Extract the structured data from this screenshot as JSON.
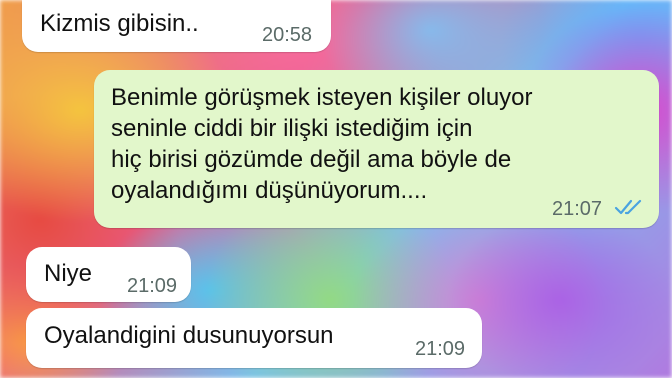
{
  "chat": {
    "messages": [
      {
        "direction": "incoming",
        "text": "Kizmis gibisin..",
        "time": "20:58"
      },
      {
        "direction": "outgoing",
        "text": "Benimle görüşmek isteyen kişiler oluyor\nseninle ciddi bir ilişki istediğim için\nhiç birisi gözümde değil ama böyle de\noyalandığımı düşünüyorum....",
        "time": "21:07",
        "status_icon": "double-check-read-icon",
        "status_color": "#4aa3e0"
      },
      {
        "direction": "incoming",
        "text": "Niye",
        "time": "21:09"
      },
      {
        "direction": "incoming",
        "text": "Oyalandigini dusunuyorsun",
        "time": "21:09"
      }
    ]
  },
  "colors": {
    "incoming_bubble": "#ffffff",
    "outgoing_bubble": "#e2f7cb",
    "time_text": "#5b6b68",
    "read_ticks": "#4aa3e0"
  }
}
